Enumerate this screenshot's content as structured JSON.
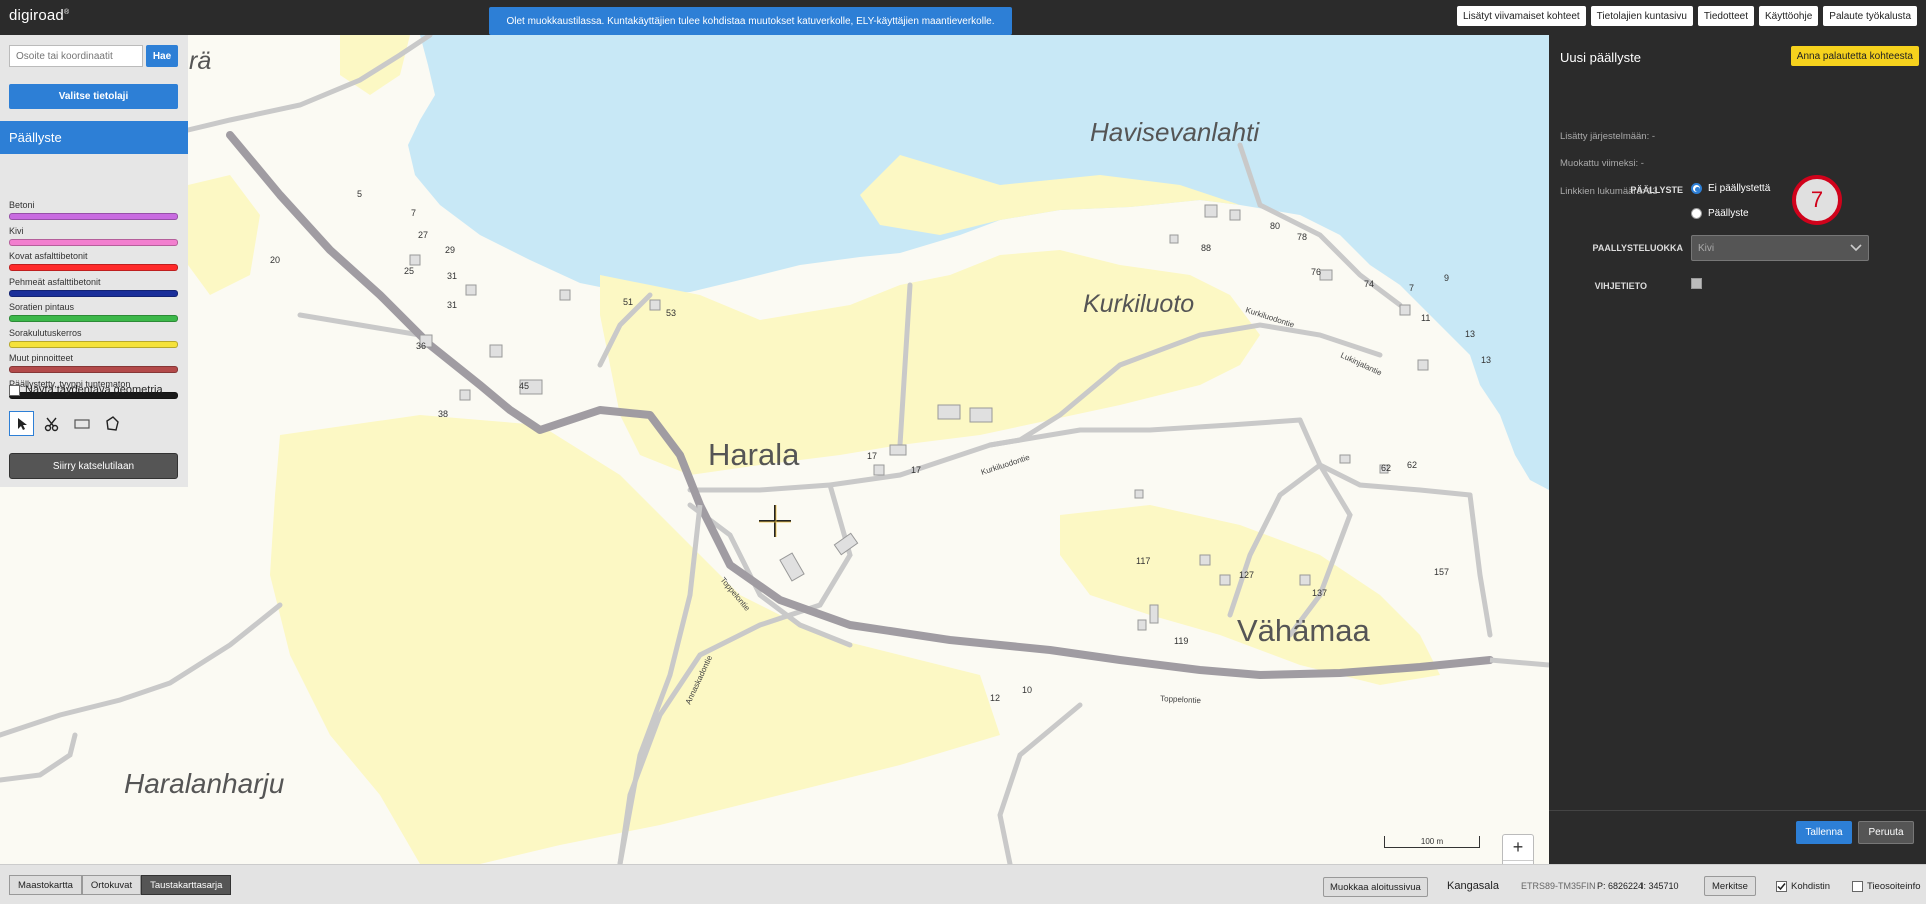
{
  "header": {
    "logo": "digiroad",
    "logo_mark": "®",
    "notice": "Olet muokkaustilassa. Kuntakäyttäjien tulee kohdistaa muutokset katuverkolle, ELY-käyttäjien maantieverkolle.",
    "links": [
      "Lisätyt viivamaiset kohteet",
      "Tietolajien kuntasivu",
      "Tiedotteet",
      "Käyttöohje",
      "Palaute työkalusta"
    ]
  },
  "left_panel": {
    "search_placeholder": "Osoite tai koordinaatit",
    "search_button": "Hae",
    "select_layer_button": "Valitse tietolaji",
    "layer_title": "Päällyste",
    "legend": [
      {
        "label": "Betoni",
        "color": "#c86be0"
      },
      {
        "label": "Kivi",
        "color": "#f27fcf"
      },
      {
        "label": "Kovat asfalttibetonit",
        "color": "#ff2a2a"
      },
      {
        "label": "Pehmeät asfalttibetonit",
        "color": "#1a2f9a"
      },
      {
        "label": "Soratien pintaus",
        "color": "#3cb84a"
      },
      {
        "label": "Sorakulutuskerros",
        "color": "#f5e23b"
      },
      {
        "label": "Muut pinnoitteet",
        "color": "#b34a4a"
      },
      {
        "label": "Päällystetty, tyyppi tuntematon",
        "color": "#1a1a1a"
      }
    ],
    "show_geometry_label": "Näytä täydentävä geometria",
    "tools": [
      "select-tool",
      "cut-tool",
      "rectangle-tool",
      "polygon-tool"
    ],
    "view_mode_button": "Siirry katselutilaan"
  },
  "map": {
    "place_labels": {
      "havisevanlahti": "Havisevanlahti",
      "kurkiluoto": "Kurkiluoto",
      "harala": "Harala",
      "vahamaa": "Vähämaa",
      "haralanharju": "Haralanharju",
      "ra": "rä"
    },
    "house_numbers": [
      "5",
      "7",
      "27",
      "29",
      "20",
      "25",
      "31",
      "31",
      "36",
      "45",
      "38",
      "51",
      "53",
      "17",
      "17",
      "117",
      "127",
      "119",
      "137",
      "157",
      "62",
      "62",
      "80",
      "78",
      "88",
      "76",
      "74",
      "7",
      "9",
      "11",
      "13",
      "13",
      "10",
      "12"
    ],
    "road_names": [
      "Kurkiluodontie",
      "Lukinjalantie",
      "Kurkiluodontie",
      "Toppelontie",
      "Annaskadontie",
      "Toppelontie"
    ],
    "scale_label": "100 m",
    "zoom_in": "+",
    "zoom_out": "−"
  },
  "right_panel": {
    "title": "Uusi päällyste",
    "feedback_button": "Anna palautetta kohteesta",
    "added": "Lisätty järjestelmään: -",
    "modified": "Muokattu viimeksi: -",
    "link_count": "Linkkien lukumäärä: 13",
    "field_surface": "PÄÄLLYSTE",
    "radio_none": "Ei päällystettä",
    "radio_surface": "Päällyste",
    "selected_radio": "Ei päällystettä",
    "field_class": "PAALLYSTELUOKKA",
    "class_value": "Kivi",
    "field_hint": "VIHJETIETO",
    "badge_number": "7",
    "save_button": "Tallenna",
    "cancel_button": "Peruuta"
  },
  "bottom_bar": {
    "basemaps": [
      "Maastokartta",
      "Ortokuvat",
      "Taustakarttasarja"
    ],
    "active_basemap": "Taustakarttasarja",
    "edit_start_button": "Muokkaa aloitussivua",
    "municipality": "Kangasala",
    "crs": "ETRS89-TM35FIN",
    "coord_p": "P: 6826224",
    "coord_i": "I: 345710",
    "mark_button": "Merkitse",
    "crosshair_label": "Kohdistin",
    "crosshair_checked": true,
    "roadinfo_label": "Tieosoiteinfo",
    "roadinfo_checked": false
  },
  "colors": {
    "accent": "#2d7fd6",
    "dark_panel": "#2b2b2b",
    "feedback_yellow": "#f6d21d",
    "badge_red": "#d0021b"
  }
}
